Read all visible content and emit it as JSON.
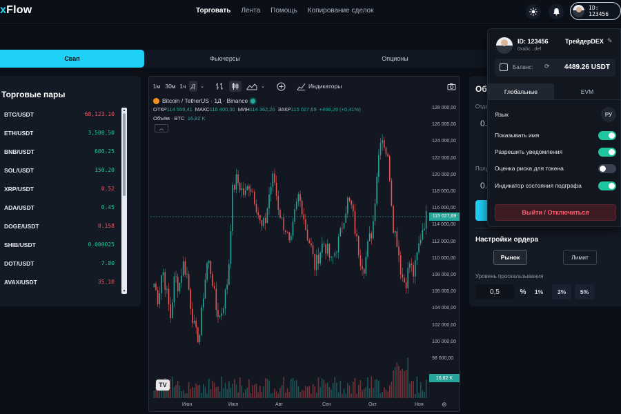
{
  "app": {
    "logo_prefix": "x",
    "logo_rest": "Flow"
  },
  "nav": [
    "Торговать",
    "Лента",
    "Помощь",
    "Копирование сделок"
  ],
  "header": {
    "user_id": "ID: 123456"
  },
  "tabs": [
    "Свап",
    "Фьючерсы",
    "Опционы"
  ],
  "pairs": {
    "title": "Торговые пары",
    "items": [
      {
        "symbol": "BTC/USDT",
        "price": "68,123.10",
        "dir": "down"
      },
      {
        "symbol": "ETH/USDT",
        "price": "3,500.50",
        "dir": "up"
      },
      {
        "symbol": "BNB/USDT",
        "price": "600.25",
        "dir": "up"
      },
      {
        "symbol": "SOL/USDT",
        "price": "150.20",
        "dir": "up"
      },
      {
        "symbol": "XRP/USDT",
        "price": "0.52",
        "dir": "down"
      },
      {
        "symbol": "ADA/USDT",
        "price": "0.45",
        "dir": "up"
      },
      {
        "symbol": "DOGE/USDT",
        "price": "0.158",
        "dir": "down"
      },
      {
        "symbol": "SHIB/USDT",
        "price": "0.000025",
        "dir": "up"
      },
      {
        "symbol": "DOT/USDT",
        "price": "7.80",
        "dir": "up"
      },
      {
        "symbol": "AVAX/USDT",
        "price": "35.10",
        "dir": "down"
      }
    ]
  },
  "colors": {
    "up": "#1ec6a0",
    "down": "#f2545b",
    "accent": "#1fd0f6",
    "candle_up": "#26a69a",
    "candle_down": "#ef5350"
  },
  "chart": {
    "toolbar": {
      "tf1": "1м",
      "tf2": "30м",
      "tf3": "1ч",
      "indicators": "Индикаторы"
    },
    "symbol": "Bitcoin / TetherUS · 1Д · Binance",
    "ohlc": {
      "o_label": "ОТКР",
      "o": "114 559,41",
      "h_label": "МАКС",
      "h": "116 400,00",
      "l_label": "МИН",
      "l": "114 362,26",
      "c_label": "ЗАКР",
      "c": "115 027,69",
      "chg": "+468,29 (+0,41%)"
    },
    "volume": {
      "label": "Объём · BTC",
      "value": "16,82 K"
    },
    "last_price": "115 027,69",
    "last_volume": "16,82 K"
  },
  "chart_data": {
    "type": "candlestick",
    "yticks": [
      "128 000,00",
      "126 000,00",
      "124 000,00",
      "122 000,00",
      "120 000,00",
      "118 000,00",
      "116 000,00",
      "114 000,00",
      "112 000,00",
      "110 000,00",
      "108 000,00",
      "106 000,00",
      "104 000,00",
      "102 000,00",
      "100 000,00",
      "98 000,00"
    ],
    "ylim": [
      97000,
      129000
    ],
    "xticks": [
      "Июн",
      "Июл",
      "Авг",
      "Сен",
      "Окт",
      "Ноя"
    ],
    "close_anchors": [
      107000,
      105000,
      109000,
      106000,
      103000,
      108000,
      106500,
      109500,
      108000,
      104000,
      101000,
      100500,
      106000,
      110000,
      108000,
      104000,
      103000,
      105000,
      108000,
      118000,
      119500,
      118500,
      117500,
      119000,
      118000,
      116000,
      113500,
      114500,
      118000,
      120000,
      116500,
      114500,
      113500,
      111000,
      115000,
      117500,
      116000,
      113000,
      111500,
      109000,
      110500,
      112000,
      111000,
      109500,
      111000,
      112500,
      115000,
      117000,
      116000,
      112500,
      110000,
      109000,
      112000,
      113500,
      120000,
      125000,
      123500,
      121000,
      114000,
      112000,
      108000,
      107000,
      109500,
      108000,
      111000,
      113500,
      115000
    ]
  },
  "order": {
    "title": "Об",
    "sub1": "Отда",
    "val1": "0.",
    "sub2": "Полу",
    "val2": "0.",
    "settings_title": "Настройки ордера",
    "market": "Рынок",
    "limit": "Лимит",
    "slip_label": "Уровень проскальзывания",
    "slip_value": "0,5",
    "pct_sign": "%",
    "p1": "1%",
    "p2": "3%",
    "p3": "5%"
  },
  "dropdown": {
    "id": "ID: 123456",
    "address": "0xabc...def",
    "name": "ТрейдерDEX",
    "balance_label": "Баланс:",
    "balance_value": "4489.26 USDT",
    "tab_global": "Глобальные",
    "tab_evm": "EVM",
    "lang_label": "Язык",
    "lang_value": "РУ",
    "settings": [
      {
        "label": "Показывать имя",
        "on": true
      },
      {
        "label": "Разрешить уведомления",
        "on": true
      },
      {
        "label": "Оценка риска для токена",
        "on": false
      },
      {
        "label": "Индикатор состояния подграфа",
        "on": true
      }
    ],
    "logout": "Выйти / Отключиться"
  }
}
